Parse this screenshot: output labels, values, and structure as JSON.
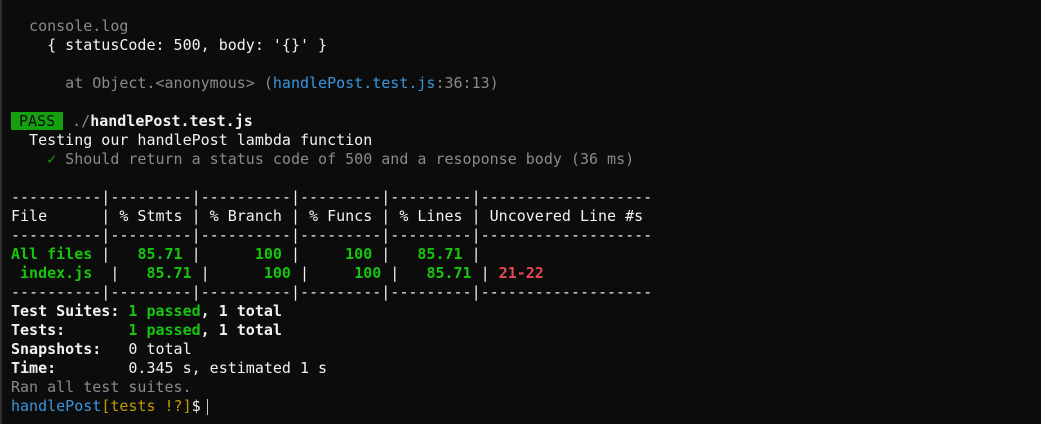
{
  "console_log": {
    "label": "  console.log",
    "object": "    { statusCode: 500, body: '{}' }",
    "trace_prefix": "      at Object.<anonymous> (",
    "trace_file": "handlePost.test.js",
    "trace_suffix": ":36:13)"
  },
  "result": {
    "badge": "PASS",
    "path_dir": " ./",
    "path_file": "handlePost.test.js",
    "describe": "  Testing our handlePost lambda function",
    "check_mark": "    ✓",
    "test_name": " Should return a status code of 500 and a resoponse body (36 ms)"
  },
  "coverage": {
    "separator": "----------|---------|----------|---------|---------|-------------------",
    "header": "File      | % Stmts | % Branch | % Funcs | % Lines | Uncovered Line #s ",
    "rows": [
      {
        "file": "All files",
        "stmts": "85.71",
        "branch": "100",
        "funcs": "100",
        "lines": "85.71",
        "uncovered": ""
      },
      {
        "file": " index.js",
        "stmts": "85.71",
        "branch": "100",
        "funcs": "100",
        "lines": "85.71",
        "uncovered": "21-22"
      }
    ]
  },
  "summary": {
    "suites_label": "Test Suites: ",
    "suites_passed": "1 passed",
    "suites_total": ", 1 total",
    "tests_label": "Tests:       ",
    "tests_passed": "1 passed",
    "tests_total": ", 1 total",
    "snapshots_label": "Snapshots:   ",
    "snapshots_value": "0 total",
    "time_label": "Time:        ",
    "time_value": "0.345 s, estimated 1 s",
    "ran_all": "Ran all test suites."
  },
  "prompt": {
    "dir": "handlePost",
    "branch": "[tests !?]",
    "symbol": "$"
  }
}
